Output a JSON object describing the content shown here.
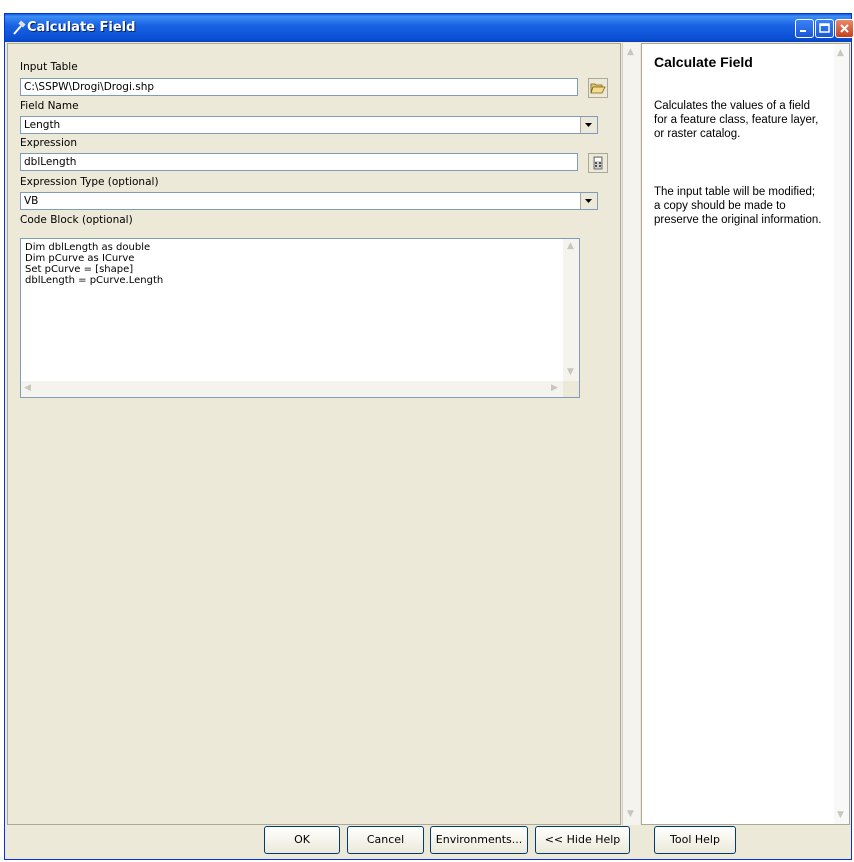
{
  "window": {
    "title": "Calculate Field"
  },
  "form": {
    "input_table": {
      "label": "Input Table",
      "value": "C:\\SSPW\\Drogi\\Drogi.shp"
    },
    "field_name": {
      "label": "Field Name",
      "value": "Length"
    },
    "expression": {
      "label": "Expression",
      "value": "dblLength"
    },
    "expression_type": {
      "label": "Expression Type (optional)",
      "value": "VB"
    },
    "code_block": {
      "label": "Code Block (optional)",
      "lines": [
        "Dim dblLength as double",
        "Dim pCurve as ICurve",
        "Set pCurve = [shape]",
        "dblLength = pCurve.Length"
      ]
    }
  },
  "help": {
    "title": "Calculate Field",
    "paragraph1": "Calculates the values of a field for a feature class, feature layer, or raster catalog.",
    "paragraph2": "The input table will be modified; a copy should be made to preserve the original information."
  },
  "buttons": {
    "ok": "OK",
    "cancel": "Cancel",
    "environments": "Environments...",
    "hide_help": "<< Hide Help",
    "tool_help": "Tool Help"
  },
  "colors": {
    "titlebar": "#0a4fd4",
    "dialog_bg": "#ece9d8",
    "input_border": "#7f9db9"
  }
}
